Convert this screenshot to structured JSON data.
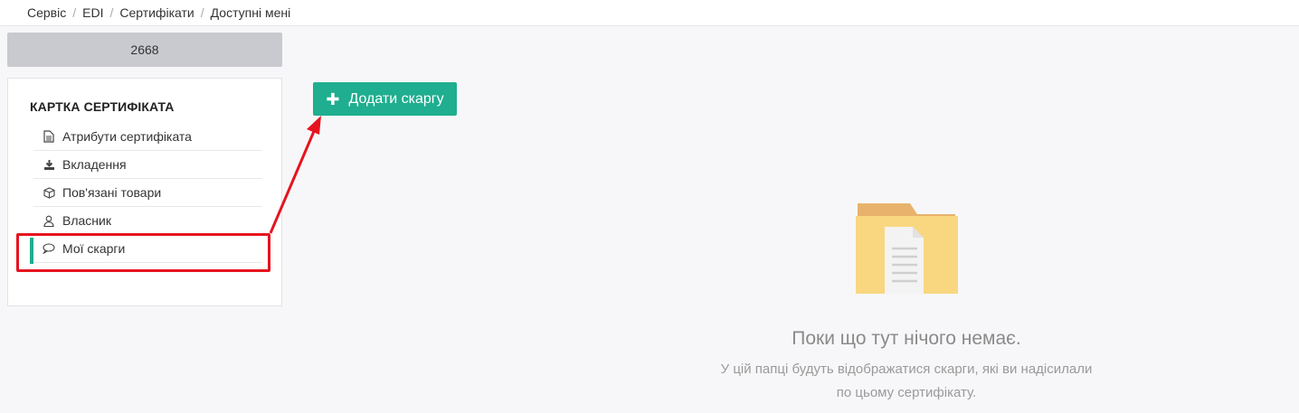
{
  "breadcrumb": [
    "Сервіс",
    "EDI",
    "Сертифікати",
    "Доступні мені"
  ],
  "certificate_number": "2668",
  "card": {
    "title": "КАРТКА СЕРТИФІКАТА",
    "items": [
      {
        "label": "Атрибути сертифіката",
        "icon": "document-icon"
      },
      {
        "label": "Вкладення",
        "icon": "download-icon"
      },
      {
        "label": "Пов'язані товари",
        "icon": "box-icon"
      },
      {
        "label": "Власник",
        "icon": "user-icon"
      },
      {
        "label": "Мої скарги",
        "icon": "comment-icon",
        "active": true
      }
    ]
  },
  "add_button_label": "Додати скаргу",
  "empty_state": {
    "title": "Поки що тут нічого немає.",
    "description_line1": "У цій папці будуть відображатися скарги, які ви надісилали",
    "description_line2": "по цьому сертифікату."
  },
  "colors": {
    "accent": "#1fae8f",
    "annotation": "#e6141e"
  }
}
